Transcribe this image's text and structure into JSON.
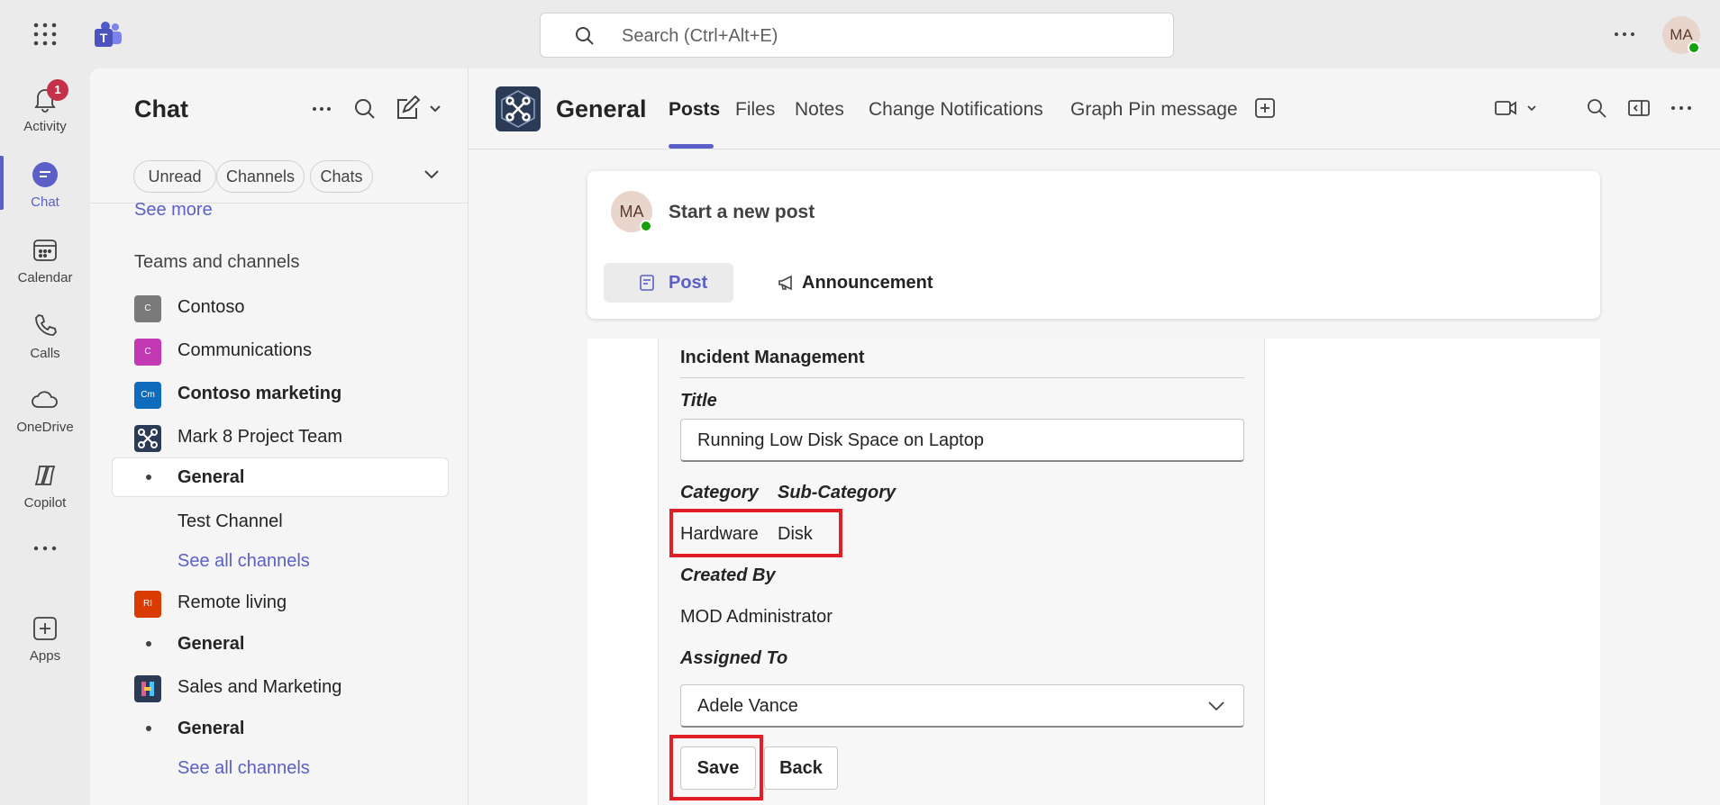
{
  "top": {
    "search_placeholder": "Search (Ctrl+Alt+E)",
    "avatar_initials": "MA"
  },
  "rail": {
    "items": [
      {
        "label": "Activity",
        "icon": "bell-icon",
        "badge": "1"
      },
      {
        "label": "Chat",
        "icon": "chat-icon"
      },
      {
        "label": "Calendar",
        "icon": "calendar-icon"
      },
      {
        "label": "Calls",
        "icon": "phone-icon"
      },
      {
        "label": "OneDrive",
        "icon": "cloud-icon"
      },
      {
        "label": "Copilot",
        "icon": "copilot-icon"
      },
      {
        "label": "Apps",
        "icon": "add-app-icon"
      }
    ],
    "active": "Chat"
  },
  "chat": {
    "title": "Chat",
    "filters": [
      "Unread",
      "Channels",
      "Chats"
    ],
    "see_more": "See more",
    "section": "Teams and channels",
    "teams": [
      {
        "name": "Contoso",
        "initials": "C",
        "color": "#7a7a7a"
      },
      {
        "name": "Communications",
        "initials": "C",
        "color": "#c239b3"
      },
      {
        "name": "Contoso marketing",
        "initials": "Cm",
        "color": "#0f6cbd"
      },
      {
        "name": "Mark 8 Project Team",
        "initials": "",
        "color": "#2b3a55"
      },
      {
        "name": "Remote living",
        "initials": "RI",
        "color": "#da3b01"
      },
      {
        "name": "Sales and Marketing",
        "initials": "",
        "color": "#2b3a55"
      }
    ],
    "channels": {
      "mark8_general": "General",
      "test_channel": "Test Channel",
      "see_all_1": "See all channels",
      "remote_general": "General",
      "sales_general": "General",
      "see_all_2": "See all channels"
    }
  },
  "channel": {
    "name": "General",
    "tabs": [
      "Posts",
      "Files",
      "Notes",
      "Change Notifications",
      "Graph Pin message"
    ]
  },
  "newpost": {
    "initials": "MA",
    "placeholder": "Start a new post",
    "post_label": "Post",
    "announcement_label": "Announcement"
  },
  "card": {
    "title": "Incident Management",
    "title_label": "Title",
    "title_value": "Running Low Disk Space on Laptop",
    "category_label": "Category",
    "subcategory_label": "Sub-Category",
    "category_value": "Hardware",
    "subcategory_value": "Disk",
    "created_by_label": "Created By",
    "created_by_value": "MOD Administrator",
    "assigned_to_label": "Assigned To",
    "assigned_to_value": "Adele Vance",
    "save_label": "Save",
    "back_label": "Back"
  },
  "colors": {
    "accent": "#5b5fc7",
    "highlight": "#e01f26",
    "presence": "#13a10e"
  }
}
